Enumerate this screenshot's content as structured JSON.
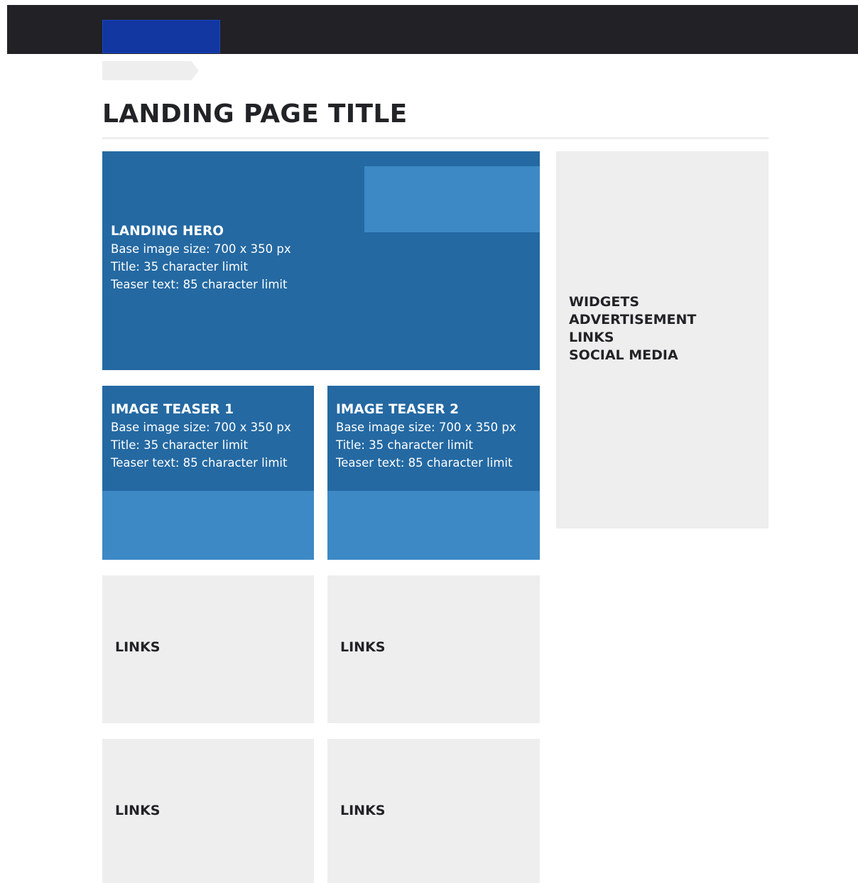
{
  "page_title": "LANDING PAGE TITLE",
  "hero": {
    "heading": "LANDING HERO",
    "lines": [
      "Base image size: 700 x 350 px",
      "Title: 35 character limit",
      "Teaser text: 85 character limit"
    ]
  },
  "teasers": [
    {
      "heading": "IMAGE TEASER 1",
      "lines": [
        "Base image size: 700 x 350 px",
        "Title: 35 character limit",
        "Teaser text: 85 character limit"
      ]
    },
    {
      "heading": "IMAGE TEASER 2",
      "lines": [
        "Base image size: 700 x 350 px",
        "Title: 35 character limit",
        "Teaser text: 85 character limit"
      ]
    }
  ],
  "sidebar": {
    "items": [
      "WIDGETS",
      "ADVERTISEMENT",
      "LINKS",
      "SOCIAL MEDIA"
    ]
  },
  "links_boxes": [
    {
      "label": "LINKS"
    },
    {
      "label": "LINKS"
    },
    {
      "label": "LINKS"
    },
    {
      "label": "LINKS"
    }
  ],
  "colors": {
    "header_bg": "#222126",
    "logo": "#1237a0",
    "hero_dark": "#2469a2",
    "hero_light": "#3c89c6",
    "placeholder_gray": "#eeeeee",
    "text_dark": "#222327"
  }
}
